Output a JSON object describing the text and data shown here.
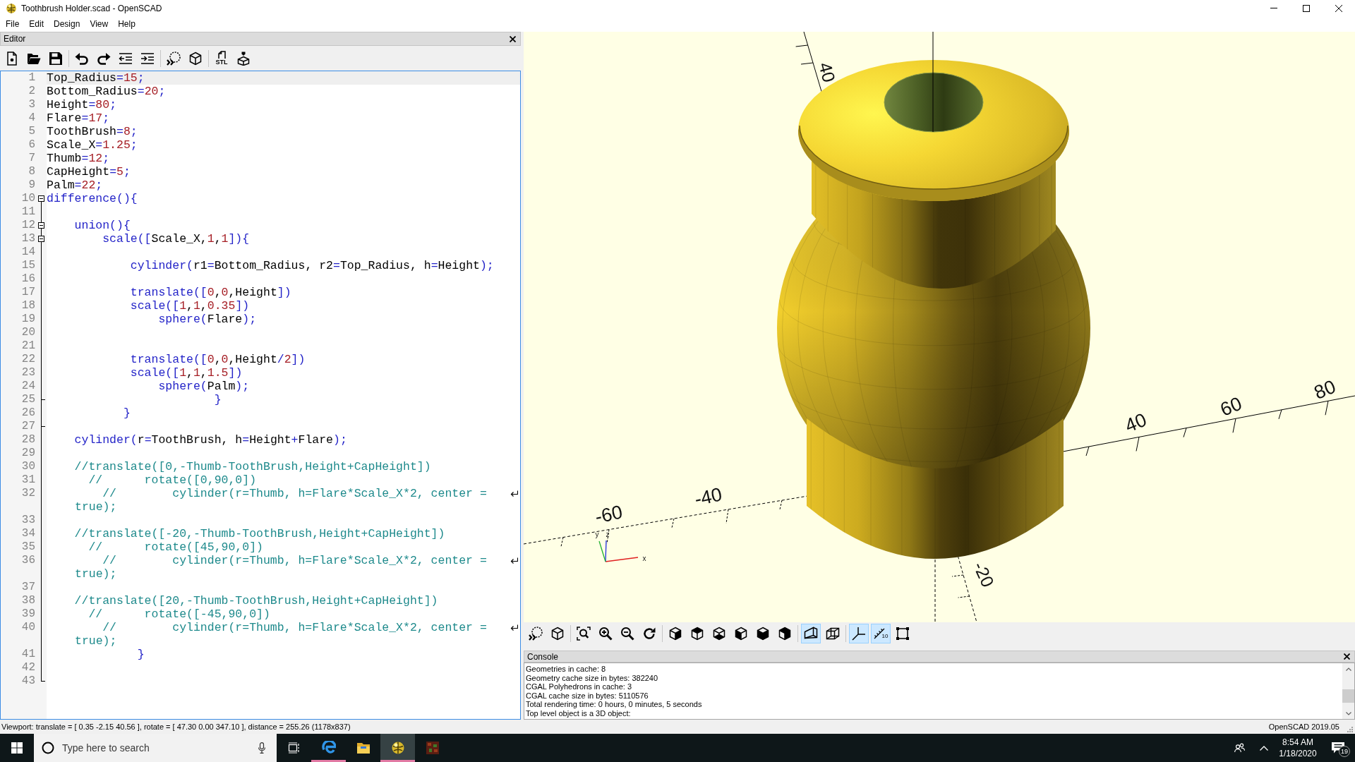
{
  "window": {
    "title": "Toothbrush Holder.scad - OpenSCAD"
  },
  "menu": [
    "File",
    "Edit",
    "Design",
    "View",
    "Help"
  ],
  "editor": {
    "title": "Editor",
    "toolbar": [
      [
        {
          "kind": "new"
        },
        {
          "kind": "open"
        },
        {
          "kind": "save"
        }
      ],
      [
        {
          "kind": "undo"
        },
        {
          "kind": "redo"
        },
        {
          "kind": "unindent"
        },
        {
          "kind": "indent"
        }
      ],
      [
        {
          "kind": "preview"
        },
        {
          "kind": "render"
        }
      ],
      [
        {
          "kind": "export",
          "label": "STL"
        },
        {
          "kind": "print"
        }
      ]
    ],
    "lines": [
      {
        "number": "1",
        "kind": "code",
        "current": true,
        "tokens": [
          {
            "kind": "text",
            "text": "Top_Radius"
          },
          {
            "kind": "keyword",
            "text": "="
          },
          {
            "kind": "number",
            "text": "15"
          },
          {
            "kind": "keyword",
            "text": ";"
          }
        ]
      },
      {
        "number": "2",
        "kind": "code",
        "current": false,
        "tokens": [
          {
            "kind": "text",
            "text": "Bottom_Radius"
          },
          {
            "kind": "keyword",
            "text": "="
          },
          {
            "kind": "number",
            "text": "20"
          },
          {
            "kind": "keyword",
            "text": ";"
          }
        ]
      },
      {
        "number": "3",
        "kind": "code",
        "current": false,
        "tokens": [
          {
            "kind": "text",
            "text": "Height"
          },
          {
            "kind": "keyword",
            "text": "="
          },
          {
            "kind": "number",
            "text": "80"
          },
          {
            "kind": "keyword",
            "text": ";"
          }
        ]
      },
      {
        "number": "4",
        "kind": "code",
        "current": false,
        "tokens": [
          {
            "kind": "text",
            "text": "Flare"
          },
          {
            "kind": "keyword",
            "text": "="
          },
          {
            "kind": "number",
            "text": "17"
          },
          {
            "kind": "keyword",
            "text": ";"
          }
        ]
      },
      {
        "number": "5",
        "kind": "code",
        "current": false,
        "tokens": [
          {
            "kind": "text",
            "text": "ToothBrush"
          },
          {
            "kind": "keyword",
            "text": "="
          },
          {
            "kind": "number",
            "text": "8"
          },
          {
            "kind": "keyword",
            "text": ";"
          }
        ]
      },
      {
        "number": "6",
        "kind": "code",
        "current": false,
        "tokens": [
          {
            "kind": "text",
            "text": "Scale_X"
          },
          {
            "kind": "keyword",
            "text": "="
          },
          {
            "kind": "number",
            "text": "1.25"
          },
          {
            "kind": "keyword",
            "text": ";"
          }
        ]
      },
      {
        "number": "7",
        "kind": "code",
        "current": false,
        "tokens": [
          {
            "kind": "text",
            "text": "Thumb"
          },
          {
            "kind": "keyword",
            "text": "="
          },
          {
            "kind": "number",
            "text": "12"
          },
          {
            "kind": "keyword",
            "text": ";"
          }
        ]
      },
      {
        "number": "8",
        "kind": "code",
        "current": false,
        "tokens": [
          {
            "kind": "text",
            "text": "CapHeight"
          },
          {
            "kind": "keyword",
            "text": "="
          },
          {
            "kind": "number",
            "text": "5"
          },
          {
            "kind": "keyword",
            "text": ";"
          }
        ]
      },
      {
        "number": "9",
        "kind": "code",
        "current": false,
        "tokens": [
          {
            "kind": "text",
            "text": "Palm"
          },
          {
            "kind": "keyword",
            "text": "="
          },
          {
            "kind": "number",
            "text": "22"
          },
          {
            "kind": "keyword",
            "text": ";"
          }
        ]
      },
      {
        "number": "10",
        "kind": "foldstart",
        "current": false,
        "tokens": [
          {
            "kind": "keyword",
            "text": "difference(){"
          }
        ]
      },
      {
        "number": "11",
        "kind": "foldbody",
        "current": false
      },
      {
        "number": "12",
        "kind": "foldstart",
        "current": false,
        "tokens": [
          {
            "kind": "keyword",
            "text": "    union(){"
          }
        ]
      },
      {
        "number": "13",
        "kind": "foldstart",
        "current": false,
        "tokens": [
          {
            "kind": "keyword",
            "text": "        scale(["
          },
          {
            "kind": "text",
            "text": "Scale_X,"
          },
          {
            "kind": "number",
            "text": "1"
          },
          {
            "kind": "text",
            "text": ","
          },
          {
            "kind": "number",
            "text": "1"
          },
          {
            "kind": "keyword",
            "text": "]){"
          }
        ]
      },
      {
        "number": "14",
        "kind": "foldbody",
        "current": false
      },
      {
        "number": "15",
        "kind": "foldbody",
        "current": false,
        "tokens": [
          {
            "kind": "keyword",
            "text": "            cylinder("
          },
          {
            "kind": "text",
            "text": "r1"
          },
          {
            "kind": "keyword",
            "text": "="
          },
          {
            "kind": "text",
            "text": "Bottom_Radius, r2"
          },
          {
            "kind": "keyword",
            "text": "="
          },
          {
            "kind": "text",
            "text": "Top_Radius, h"
          },
          {
            "kind": "keyword",
            "text": "="
          },
          {
            "kind": "text",
            "text": "Height"
          },
          {
            "kind": "keyword",
            "text": ");"
          }
        ]
      },
      {
        "number": "16",
        "kind": "foldbody",
        "current": false
      },
      {
        "number": "17",
        "kind": "foldbody",
        "current": false,
        "tokens": [
          {
            "kind": "keyword",
            "text": "            translate(["
          },
          {
            "kind": "number",
            "text": "0"
          },
          {
            "kind": "text",
            "text": ","
          },
          {
            "kind": "number",
            "text": "0"
          },
          {
            "kind": "text",
            "text": ",Height"
          },
          {
            "kind": "keyword",
            "text": "])"
          }
        ]
      },
      {
        "number": "18",
        "kind": "foldbody",
        "current": false,
        "tokens": [
          {
            "kind": "keyword",
            "text": "            scale(["
          },
          {
            "kind": "number",
            "text": "1"
          },
          {
            "kind": "text",
            "text": ","
          },
          {
            "kind": "number",
            "text": "1"
          },
          {
            "kind": "text",
            "text": ","
          },
          {
            "kind": "number",
            "text": "0.35"
          },
          {
            "kind": "keyword",
            "text": "])"
          }
        ]
      },
      {
        "number": "19",
        "kind": "foldbody",
        "current": false,
        "tokens": [
          {
            "kind": "keyword",
            "text": "                sphere("
          },
          {
            "kind": "text",
            "text": "Flare"
          },
          {
            "kind": "keyword",
            "text": ");"
          }
        ]
      },
      {
        "number": "20",
        "kind": "foldbody",
        "current": false
      },
      {
        "number": "21",
        "kind": "foldbody",
        "current": false
      },
      {
        "number": "22",
        "kind": "foldbody",
        "current": false,
        "tokens": [
          {
            "kind": "keyword",
            "text": "            translate(["
          },
          {
            "kind": "number",
            "text": "0"
          },
          {
            "kind": "text",
            "text": ","
          },
          {
            "kind": "number",
            "text": "0"
          },
          {
            "kind": "text",
            "text": ",Height"
          },
          {
            "kind": "keyword",
            "text": "/"
          },
          {
            "kind": "number",
            "text": "2"
          },
          {
            "kind": "keyword",
            "text": "])"
          }
        ]
      },
      {
        "number": "23",
        "kind": "foldbody",
        "current": false,
        "tokens": [
          {
            "kind": "keyword",
            "text": "            scale(["
          },
          {
            "kind": "number",
            "text": "1"
          },
          {
            "kind": "text",
            "text": ","
          },
          {
            "kind": "number",
            "text": "1"
          },
          {
            "kind": "text",
            "text": ","
          },
          {
            "kind": "number",
            "text": "1.5"
          },
          {
            "kind": "keyword",
            "text": "])"
          }
        ]
      },
      {
        "number": "24",
        "kind": "foldbody",
        "current": false,
        "tokens": [
          {
            "kind": "keyword",
            "text": "                sphere("
          },
          {
            "kind": "text",
            "text": "Palm"
          },
          {
            "kind": "keyword",
            "text": ");"
          }
        ]
      },
      {
        "number": "25",
        "kind": "foldend",
        "current": false,
        "tokens": [
          {
            "kind": "keyword",
            "text": "                        }"
          }
        ]
      },
      {
        "number": "26",
        "kind": "foldbody",
        "current": false,
        "tokens": [
          {
            "kind": "keyword",
            "text": "           }"
          }
        ]
      },
      {
        "number": "27",
        "kind": "foldend",
        "current": false
      },
      {
        "number": "28",
        "kind": "foldbody",
        "current": false,
        "tokens": [
          {
            "kind": "keyword",
            "text": "    cylinder("
          },
          {
            "kind": "text",
            "text": "r"
          },
          {
            "kind": "keyword",
            "text": "="
          },
          {
            "kind": "text",
            "text": "ToothBrush, h"
          },
          {
            "kind": "keyword",
            "text": "="
          },
          {
            "kind": "text",
            "text": "Height"
          },
          {
            "kind": "keyword",
            "text": "+"
          },
          {
            "kind": "text",
            "text": "Flare"
          },
          {
            "kind": "keyword",
            "text": ");"
          }
        ]
      },
      {
        "number": "29",
        "kind": "foldbody",
        "current": false
      },
      {
        "number": "30",
        "kind": "foldbody",
        "current": false,
        "tokens": [
          {
            "kind": "comment",
            "text": "    //translate([0,-Thumb-ToothBrush,Height+CapHeight])"
          }
        ]
      },
      {
        "number": "31",
        "kind": "foldbody",
        "current": false,
        "tokens": [
          {
            "kind": "comment",
            "text": "      //      rotate([0,90,0])"
          }
        ]
      },
      {
        "number": "32",
        "kind": "foldbody",
        "current": false,
        "tokens": [
          {
            "kind": "comment",
            "text": "        //        cylinder(r=Thumb, h=Flare*Scale_X*2, center ="
          }
        ],
        "wrap": [
          {
            "kind": "comment",
            "text": "true);"
          }
        ]
      },
      {
        "number": "33",
        "kind": "foldbody",
        "current": false
      },
      {
        "number": "34",
        "kind": "foldbody",
        "current": false,
        "tokens": [
          {
            "kind": "comment",
            "text": "    //translate([-20,-Thumb-ToothBrush,Height+CapHeight])"
          }
        ]
      },
      {
        "number": "35",
        "kind": "foldbody",
        "current": false,
        "tokens": [
          {
            "kind": "comment",
            "text": "      //      rotate([45,90,0])"
          }
        ]
      },
      {
        "number": "36",
        "kind": "foldbody",
        "current": false,
        "tokens": [
          {
            "kind": "comment",
            "text": "        //        cylinder(r=Thumb, h=Flare*Scale_X*2, center ="
          }
        ],
        "wrap": [
          {
            "kind": "comment",
            "text": "true);"
          }
        ]
      },
      {
        "number": "37",
        "kind": "foldbody",
        "current": false
      },
      {
        "number": "38",
        "kind": "foldbody",
        "current": false,
        "tokens": [
          {
            "kind": "comment",
            "text": "    //translate([20,-Thumb-ToothBrush,Height+CapHeight])"
          }
        ]
      },
      {
        "number": "39",
        "kind": "foldbody",
        "current": false,
        "tokens": [
          {
            "kind": "comment",
            "text": "      //      rotate([-45,90,0])"
          }
        ]
      },
      {
        "number": "40",
        "kind": "foldbody",
        "current": false,
        "tokens": [
          {
            "kind": "comment",
            "text": "        //        cylinder(r=Thumb, h=Flare*Scale_X*2, center ="
          }
        ],
        "wrap": [
          {
            "kind": "comment",
            "text": "true);"
          }
        ]
      },
      {
        "number": "41",
        "kind": "foldbody",
        "current": false,
        "tokens": [
          {
            "kind": "keyword",
            "text": "             }"
          }
        ]
      },
      {
        "number": "42",
        "kind": "foldbody",
        "current": false
      },
      {
        "number": "43",
        "kind": "foldend",
        "current": false
      }
    ]
  },
  "viewport": {
    "x_axis_labels": [
      "-60",
      "-40",
      "40",
      "60",
      "80"
    ],
    "y_axis_labels": [
      "40",
      "-20"
    ],
    "gizmo_labels": [
      "x",
      "y",
      "z"
    ]
  },
  "view_toolbar": [
    [
      {
        "kind": "preview"
      },
      {
        "kind": "render"
      }
    ],
    [
      {
        "kind": "viewall"
      },
      {
        "kind": "zoomin"
      },
      {
        "kind": "zoomout"
      },
      {
        "kind": "reset"
      }
    ],
    [
      {
        "kind": "right"
      },
      {
        "kind": "top"
      },
      {
        "kind": "bottom"
      },
      {
        "kind": "left"
      },
      {
        "kind": "front"
      },
      {
        "kind": "back"
      }
    ],
    [
      {
        "kind": "perspective",
        "on": true
      },
      {
        "kind": "orthogonal",
        "on": false
      }
    ],
    [
      {
        "kind": "axes",
        "on": true
      },
      {
        "kind": "scales",
        "on": true,
        "label": "10"
      },
      {
        "kind": "edges",
        "on": false
      }
    ]
  ],
  "console": {
    "title": "Console",
    "lines": [
      "Geometries in cache: 8",
      "Geometry cache size in bytes: 382240",
      "CGAL Polyhedrons in cache: 3",
      "CGAL cache size in bytes: 5110576",
      "Total rendering time: 0 hours, 0 minutes, 5 seconds",
      "Top level object is a 3D object:"
    ]
  },
  "status_bar": {
    "text": "Viewport: translate = [ 0.35 -2.15 40.56 ], rotate = [ 47.30 0.00 347.10 ], distance = 255.26 (1178x837)",
    "version": "OpenSCAD 2019.05"
  },
  "taskbar": {
    "search": {
      "placeholder": "Type here to search"
    },
    "apps": [
      {
        "kind": "browser",
        "running": true,
        "selected": false
      },
      {
        "kind": "files",
        "running": false,
        "selected": false
      },
      {
        "kind": "openscad",
        "running": true,
        "selected": true
      },
      {
        "kind": "blocks",
        "running": false,
        "selected": false
      }
    ],
    "clock": {
      "time": "8:54 AM",
      "date": "1/18/2020"
    },
    "notifications": "19"
  }
}
